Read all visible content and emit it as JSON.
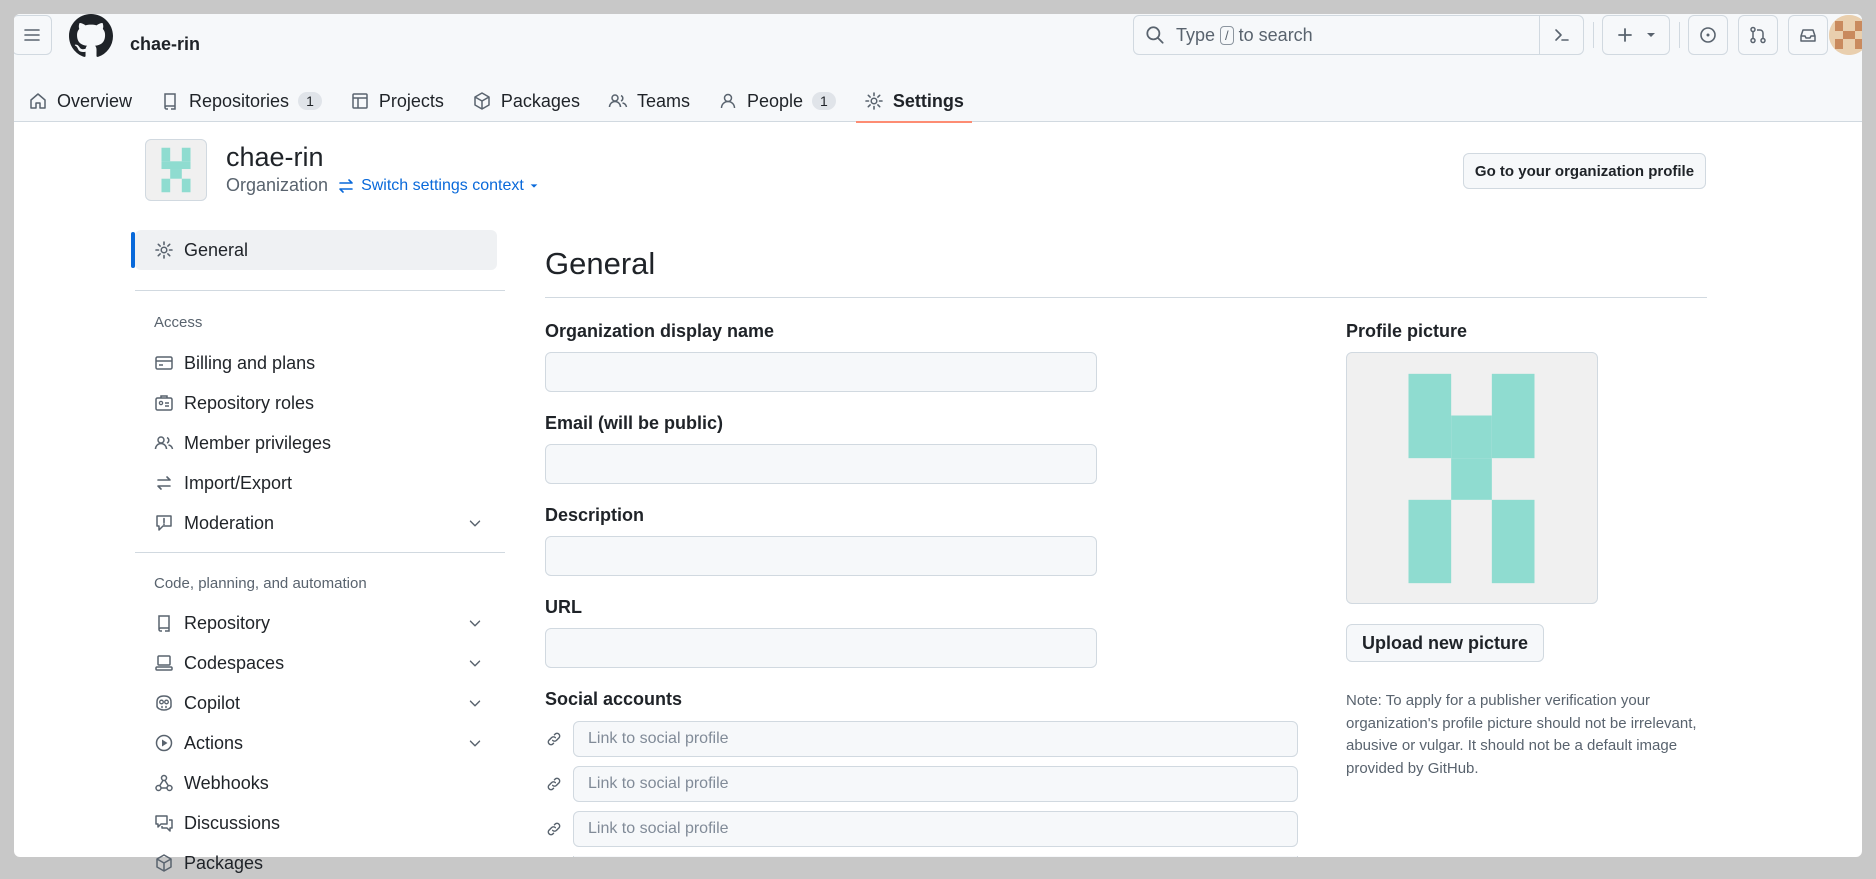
{
  "topbar": {
    "org_name": "chae-rin",
    "search_prefix": "Type",
    "search_key": "/",
    "search_suffix": "to search"
  },
  "tabs": [
    {
      "label": "Overview",
      "icon": "home-icon"
    },
    {
      "label": "Repositories",
      "icon": "repo-icon",
      "count": "1"
    },
    {
      "label": "Projects",
      "icon": "table-icon"
    },
    {
      "label": "Packages",
      "icon": "package-icon"
    },
    {
      "label": "Teams",
      "icon": "people-icon"
    },
    {
      "label": "People",
      "icon": "person-icon",
      "count": "1"
    },
    {
      "label": "Settings",
      "icon": "gear-icon",
      "active": true
    }
  ],
  "org": {
    "name": "chae-rin",
    "type": "Organization",
    "switch_context": "Switch settings context",
    "profile_button": "Go to your organization profile"
  },
  "sidebar": {
    "active_item": "General",
    "sections": [
      {
        "heading": "Access",
        "items": [
          "Billing and plans",
          "Repository roles",
          "Member privileges",
          "Import/Export",
          "Moderation"
        ]
      },
      {
        "heading": "Code, planning, and automation",
        "items": [
          "Repository",
          "Codespaces",
          "Copilot",
          "Actions",
          "Webhooks",
          "Discussions",
          "Packages"
        ]
      }
    ]
  },
  "main": {
    "title": "General",
    "fields": {
      "display_name_label": "Organization display name",
      "display_name_value": "",
      "email_label": "Email (will be public)",
      "email_value": "",
      "description_label": "Description",
      "description_value": "",
      "url_label": "URL",
      "url_value": ""
    },
    "social": {
      "label": "Social accounts",
      "placeholder": "Link to social profile"
    },
    "profile_picture": {
      "label": "Profile picture",
      "upload_button": "Upload new picture",
      "note": "Note: To apply for a publisher verification your organization's profile picture should not be irrelevant, abusive or vulgar. It should not be a default image provided by GitHub."
    }
  },
  "colors": {
    "accent": "#0969da",
    "identicon": "#8fdcd0",
    "tab_underline": "#fd8c73"
  }
}
